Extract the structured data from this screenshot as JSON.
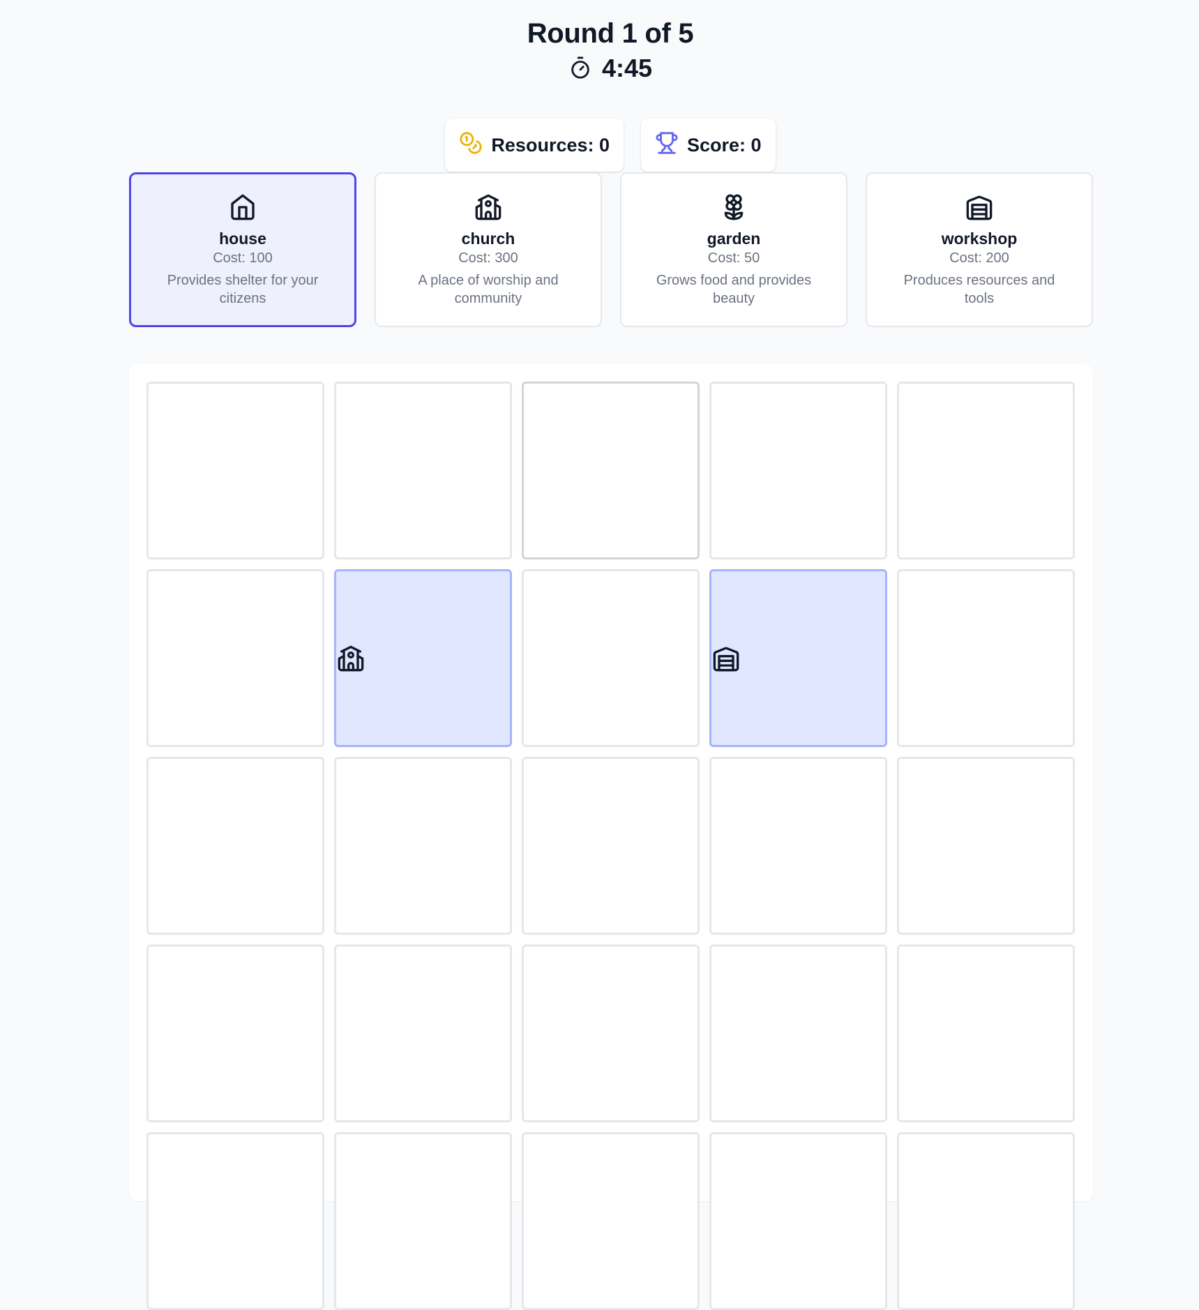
{
  "header": {
    "round": "Round 1 of 5",
    "timer": "4:45",
    "timer_icon": "stopwatch-icon"
  },
  "stats": {
    "resources_label": "Resources: 0",
    "resources_icon": "coins-icon",
    "resources_color": "#eab308",
    "score_label": "Score: 0",
    "score_icon": "trophy-icon",
    "score_color": "#6366f1"
  },
  "buildings": [
    {
      "name": "house",
      "cost": "Cost: 100",
      "desc": "Provides shelter for your citizens",
      "icon": "house-icon",
      "selected": true
    },
    {
      "name": "church",
      "cost": "Cost: 300",
      "desc": "A place of worship and community",
      "icon": "church-icon",
      "selected": false
    },
    {
      "name": "garden",
      "cost": "Cost: 50",
      "desc": "Grows food and provides beauty",
      "icon": "flower-icon",
      "selected": false
    },
    {
      "name": "workshop",
      "cost": "Cost: 200",
      "desc": "Produces resources and tools",
      "icon": "warehouse-icon",
      "selected": false
    }
  ],
  "board": {
    "columns": 5,
    "visible_rows": 5,
    "placed": [
      {
        "row": 2,
        "col": 2,
        "building": "church",
        "icon": "church-icon"
      },
      {
        "row": 2,
        "col": 4,
        "building": "workshop",
        "icon": "warehouse-icon"
      }
    ],
    "selected_color": "#4f46e5",
    "placed_color": "#e0e7ff"
  }
}
